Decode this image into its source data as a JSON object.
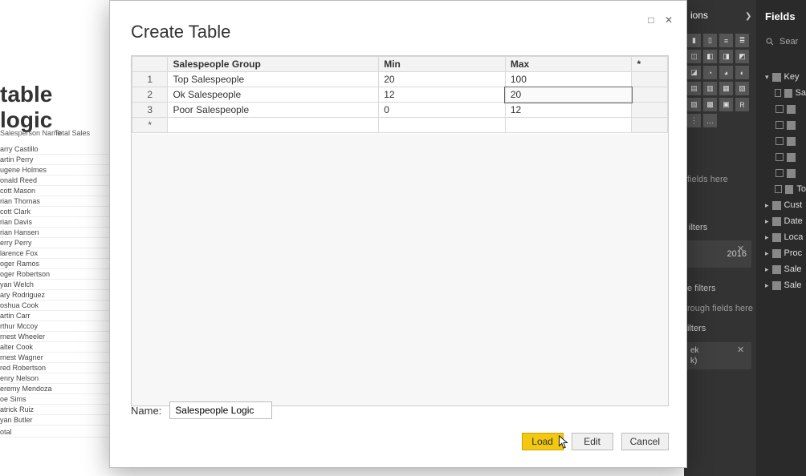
{
  "background": {
    "title_fragment": "table logic",
    "table_headers": {
      "c1": "Salesperson Name",
      "c2": "Total Sales"
    },
    "rows": [
      "arry Castillo",
      "artin Perry",
      "ugene Holmes",
      "onald Reed",
      "cott Mason",
      "rian Thomas",
      "cott Clark",
      "rian Davis",
      "rian Hansen",
      "erry Perry",
      "larence Fox",
      "oger Ramos",
      "oger Robertson",
      "yan Welch",
      "ary Rodriguez",
      "oshua Cook",
      "artin Carr",
      "rthur Mccoy",
      "rnest Wheeler",
      "alter Cook",
      "rnest Wagner",
      "red Robertson",
      "enry Nelson",
      "eremy Mendoza",
      "oe Sims",
      "atrick Ruiz",
      "yan Butler"
    ],
    "total_label": "otal",
    "visualizations_label": "ions",
    "fields_label": "Fields",
    "search_placeholder": "Sear",
    "add_fields_hint": "fields here",
    "filters_section1": "ilters",
    "filter_card1": "2016",
    "filters_section2": "e filters",
    "drillthrough_hint": "rough fields here",
    "filters_section3": "ilters",
    "filter_card2_line1": "ek",
    "filter_card2_line2": "k)",
    "field_key": "Key",
    "field_sa": "Sa",
    "field_to": "To",
    "tables": [
      "Cust",
      "Date",
      "Loca",
      "Proc",
      "Sale",
      "Sale"
    ]
  },
  "dialog": {
    "title": "Create Table",
    "columns": {
      "group": "Salespeople Group",
      "min": "Min",
      "max": "Max"
    },
    "rows": [
      {
        "idx": "1",
        "group": "Top Salespeople",
        "min": "20",
        "max": "100"
      },
      {
        "idx": "2",
        "group": "Ok Salespeople",
        "min": "12",
        "max": "20"
      },
      {
        "idx": "3",
        "group": "Poor Salespeople",
        "min": "0",
        "max": "12"
      }
    ],
    "new_row_marker": "*",
    "name_label": "Name:",
    "name_value": "Salespeople Logic",
    "buttons": {
      "load": "Load",
      "edit": "Edit",
      "cancel": "Cancel"
    }
  }
}
